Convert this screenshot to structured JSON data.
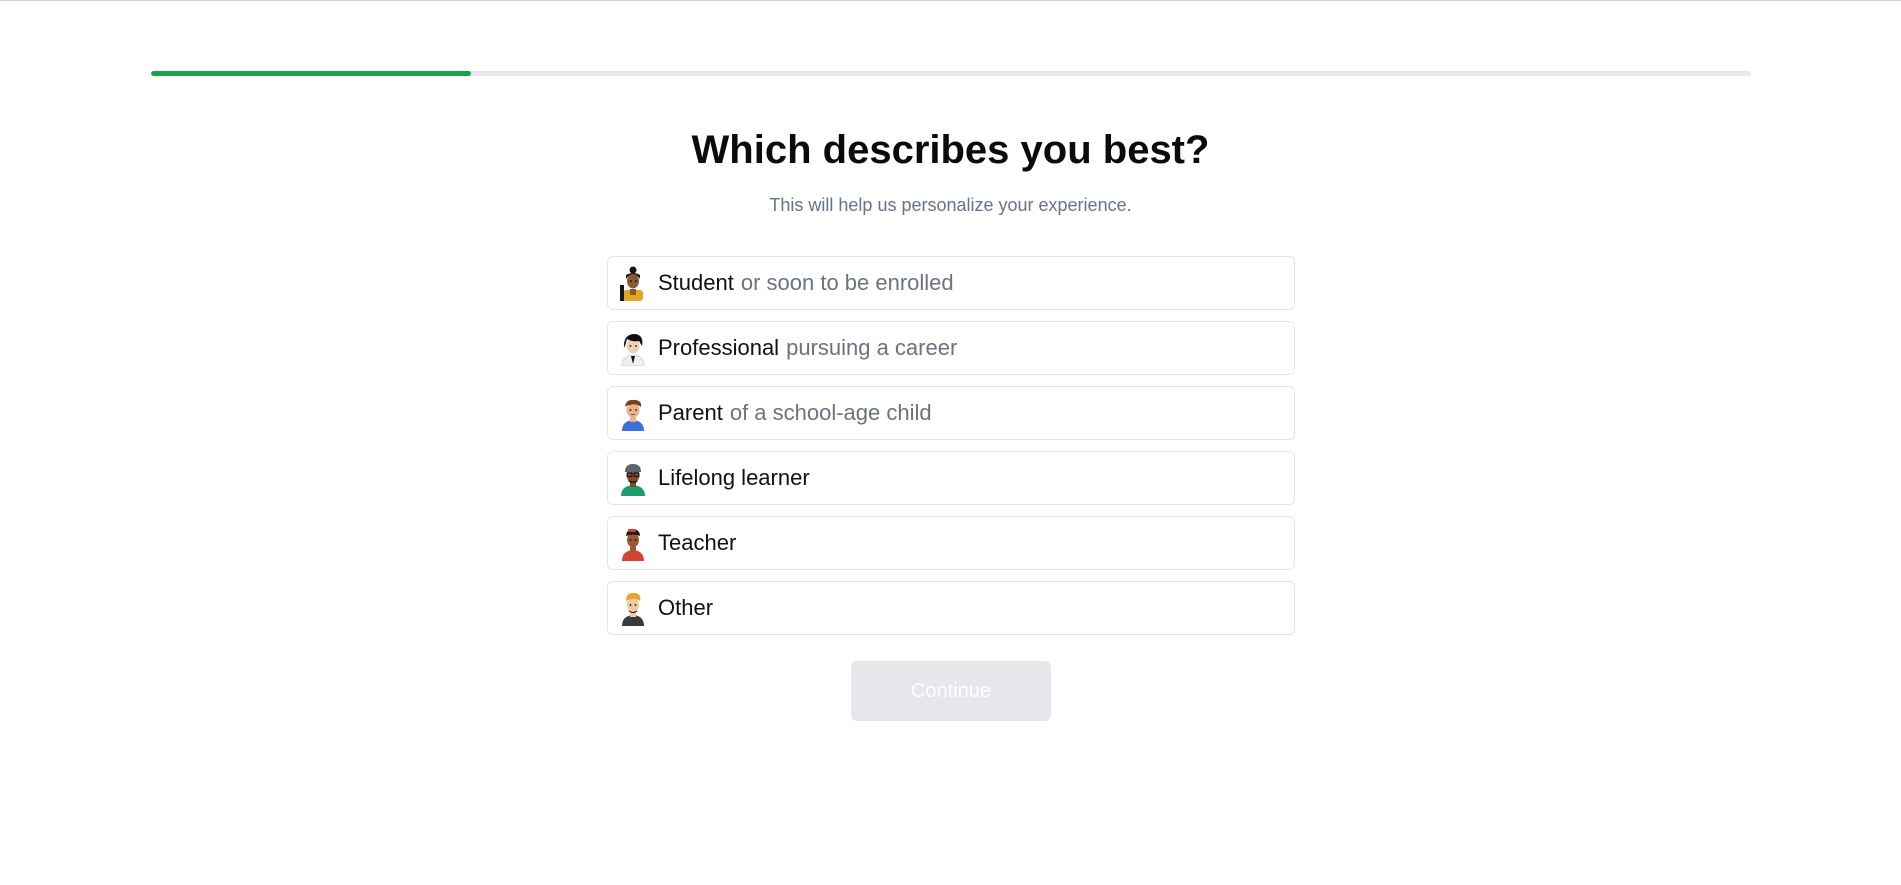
{
  "progress": {
    "fraction": 0.2,
    "color": "#16a34a"
  },
  "header": {
    "title": "Which describes you best?",
    "subtitle": "This will help us personalize your experience."
  },
  "options": [
    {
      "label": "Student",
      "sublabel": "or soon to be enrolled",
      "icon": "student-avatar-icon"
    },
    {
      "label": "Professional",
      "sublabel": "pursuing a career",
      "icon": "professional-avatar-icon"
    },
    {
      "label": "Parent",
      "sublabel": "of a school-age child",
      "icon": "parent-avatar-icon"
    },
    {
      "label": "Lifelong learner",
      "sublabel": "",
      "icon": "lifelong-learner-avatar-icon"
    },
    {
      "label": "Teacher",
      "sublabel": "",
      "icon": "teacher-avatar-icon"
    },
    {
      "label": "Other",
      "sublabel": "",
      "icon": "other-avatar-icon"
    }
  ],
  "actions": {
    "continue_label": "Continue",
    "continue_disabled": true
  }
}
